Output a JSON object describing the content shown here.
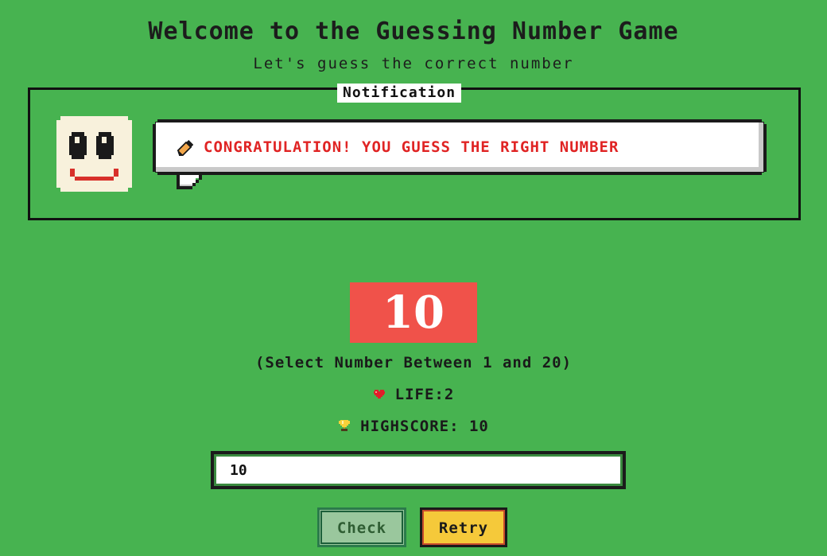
{
  "header": {
    "title": "Welcome to the Guessing Number Game",
    "subtitle": "Let's guess the correct number"
  },
  "notification": {
    "legend": "Notification",
    "message": "CONGRATULATION! YOU GUESS THE RIGHT NUMBER",
    "message_color": "#e02424",
    "icon": "pencil-icon",
    "avatar": "smiley-face"
  },
  "game": {
    "secret_number": "10",
    "range_text": "(Select Number Between 1 and 20)",
    "life_text": "LIFE:2",
    "life_icon": "heart-icon",
    "highscore_text": "HIGHSCORE: 10",
    "highscore_icon": "trophy-icon"
  },
  "input": {
    "value": "10"
  },
  "buttons": {
    "check_label": "Check",
    "retry_label": "Retry"
  },
  "colors": {
    "background": "#47b350",
    "secret_bg": "#f0524a",
    "retry_bg": "#f5c93a",
    "check_bg": "#9ac79d"
  }
}
